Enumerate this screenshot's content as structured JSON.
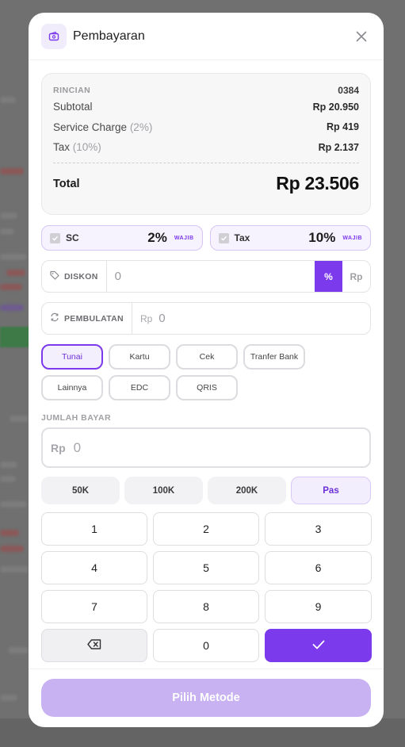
{
  "modal": {
    "title": "Pembayaran"
  },
  "summary": {
    "label": "RINCIAN",
    "code": "0384",
    "rows": [
      {
        "label": "Subtotal",
        "note": "",
        "value": "Rp 20.950"
      },
      {
        "label": "Service Charge",
        "note": "(2%)",
        "value": "Rp 419"
      },
      {
        "label": "Tax",
        "note": "(10%)",
        "value": "Rp 2.137"
      }
    ],
    "total_label": "Total",
    "total_value": "Rp 23.506"
  },
  "charges": [
    {
      "name": "SC",
      "percent": "2%",
      "badge": "WAJIB",
      "checked": true
    },
    {
      "name": "Tax",
      "percent": "10%",
      "badge": "WAJIB",
      "checked": true
    }
  ],
  "discount": {
    "label": "DISKON",
    "value": "0",
    "mode_percent": "%",
    "mode_rp": "Rp",
    "active_mode": "%"
  },
  "rounding": {
    "label": "PEMBULATAN",
    "prefix": "Rp",
    "value": "0"
  },
  "methods": [
    {
      "label": "Tunai",
      "active": true
    },
    {
      "label": "Kartu",
      "active": false
    },
    {
      "label": "Cek",
      "active": false
    },
    {
      "label": "Tranfer Bank",
      "active": false
    },
    {
      "label": "Lainnya",
      "active": false
    },
    {
      "label": "EDC",
      "active": false
    },
    {
      "label": "QRIS",
      "active": false
    }
  ],
  "amount": {
    "label": "JUMLAH BAYAR",
    "prefix": "Rp",
    "value": "0"
  },
  "quick": [
    "50K",
    "100K",
    "200K",
    "Pas"
  ],
  "keypad": [
    "1",
    "2",
    "3",
    "4",
    "5",
    "6",
    "7",
    "8",
    "9",
    "0"
  ],
  "footer": {
    "submit_label": "Pilih Metode"
  },
  "colors": {
    "accent": "#7c3aed",
    "accent_light": "#f4effd",
    "submit_disabled": "#c8b2f1"
  }
}
